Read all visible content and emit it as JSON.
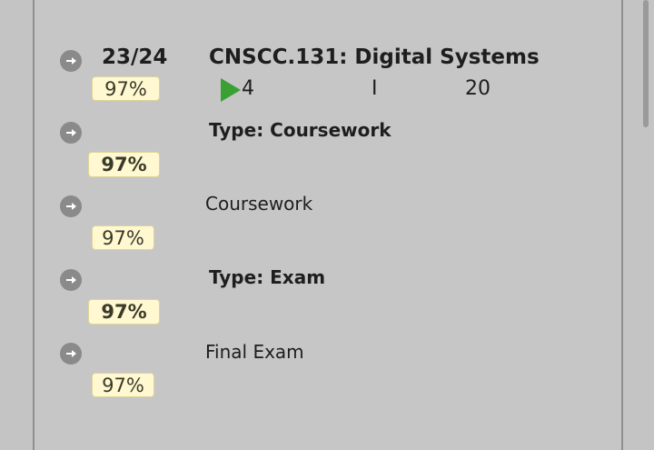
{
  "module": {
    "score": "23/24",
    "title": "CNSCC.131: Digital Systems",
    "percent": "97%",
    "detail_count": "4",
    "detail_cursor": "I",
    "detail_credits": "20"
  },
  "rows": [
    {
      "label": "Type: Coursework",
      "percent": "97%"
    },
    {
      "label": "Coursework",
      "percent": "97%"
    },
    {
      "label": "Type: Exam",
      "percent": "97%"
    },
    {
      "label": "Final Exam",
      "percent": "97%"
    }
  ],
  "colors": {
    "badge_bg": "#fff8d0",
    "play_icon": "#3aa033",
    "arrow_icon": "#8a8a8a"
  }
}
